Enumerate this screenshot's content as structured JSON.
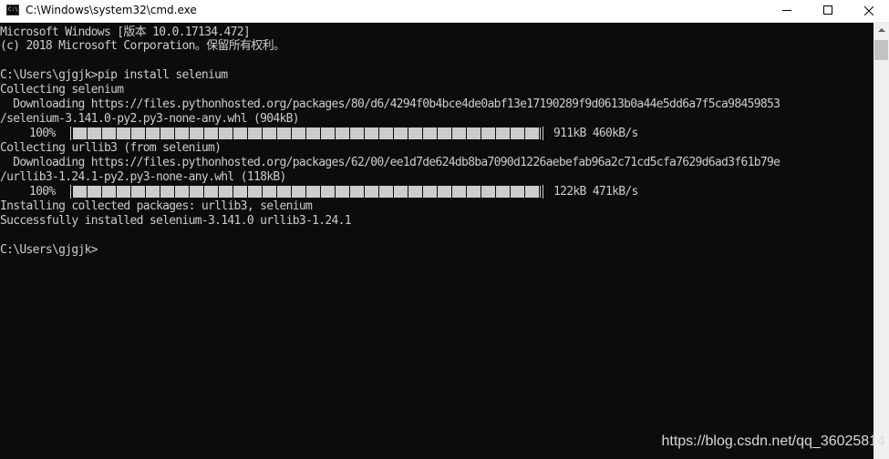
{
  "window": {
    "title": "C:\\Windows\\system32\\cmd.exe",
    "icon": "cmd-console-icon",
    "icon_text": "C:\\",
    "controls": [
      "minimize",
      "maximize",
      "close"
    ]
  },
  "console": {
    "lines": [
      "Microsoft Windows [版本 10.0.17134.472]",
      "(c) 2018 Microsoft Corporation。保留所有权利。",
      "",
      "C:\\Users\\gjgjk>pip install selenium",
      "Collecting selenium",
      "  Downloading https://files.pythonhosted.org/packages/80/d6/4294f0b4bce4de0abf13e17190289f9d0613b0a44e5dd6a7f5ca98459853",
      "/selenium-3.141.0-py2.py3-none-any.whl (904kB)",
      "",
      "Collecting urllib3 (from selenium)",
      "  Downloading https://files.pythonhosted.org/packages/62/00/ee1d7de624db8ba7090d1226aebefab96a2c71cd5cfa7629d6ad3f61b79e",
      "/urllib3-1.24.1-py2.py3-none-any.whl (118kB)",
      "",
      "Installing collected packages: urllib3, selenium",
      "Successfully installed selenium-3.141.0 urllib3-1.24.1",
      "",
      "C:\\Users\\gjgjk>"
    ],
    "progress": [
      {
        "percent_label": "100%",
        "fraction": 1.0,
        "stats": "911kB 460kB/s"
      },
      {
        "percent_label": "100%",
        "fraction": 1.0,
        "stats": "122kB 471kB/s"
      }
    ]
  },
  "watermark": "https://blog.csdn.net/qq_36025814",
  "colors": {
    "console_bg": "#0c0c0c",
    "console_fg": "#cccccc",
    "titlebar_bg": "#ffffff",
    "scrollbar_bg": "#f0f0f0",
    "scrollbar_thumb": "#c2c2c2"
  }
}
